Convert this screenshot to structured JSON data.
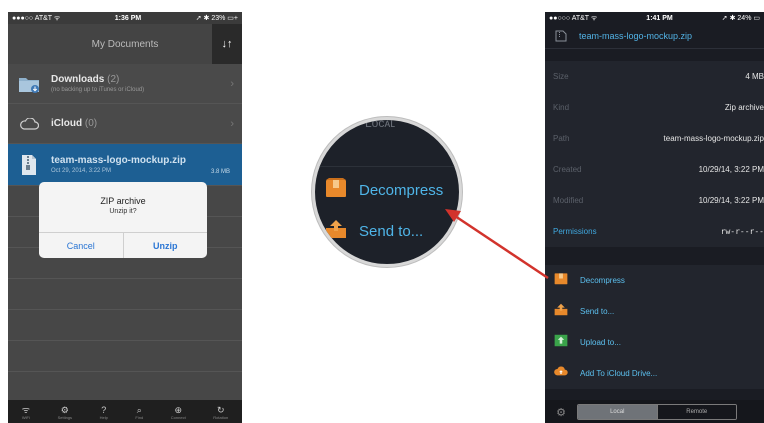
{
  "left_phone": {
    "status": {
      "carrier": "●●●○○ AT&T ᯤ",
      "time": "1:36 PM",
      "battery": "➚ ✱ 23% ▭+"
    },
    "nav": {
      "title": "My Documents",
      "sort_icon": "↓↑"
    },
    "rows": [
      {
        "name": "Downloads",
        "count": "(2)",
        "sub": "(no backing up to iTunes or iCloud)"
      },
      {
        "name": "iCloud",
        "count": "(0)",
        "sub": ""
      },
      {
        "name": "team-mass-logo-mockup.zip",
        "count": "",
        "sub": "Oct 29, 2014, 3:22 PM",
        "size": "3.8 MB"
      }
    ],
    "alert": {
      "title": "ZIP archive",
      "message": "Unzip it?",
      "cancel": "Cancel",
      "confirm": "Unzip"
    },
    "tabbar": [
      {
        "glyph": "ᯤ",
        "label": "WiFi",
        "icon": "wifi-icon"
      },
      {
        "glyph": "⚙",
        "label": "Settings",
        "icon": "gear-icon"
      },
      {
        "glyph": "?",
        "label": "Help",
        "icon": "help-icon"
      },
      {
        "glyph": "⌕",
        "label": "Find",
        "icon": "search-icon"
      },
      {
        "glyph": "⊕",
        "label": "Connect",
        "icon": "globe-icon"
      },
      {
        "glyph": "↻",
        "label": "Rotation",
        "icon": "rotate-icon"
      }
    ]
  },
  "magnifier": {
    "ghost_text": "Lᴏᴄᴀʟ",
    "items": [
      {
        "label": "Decompress",
        "icon": "decompress-icon"
      },
      {
        "label": "Send to...",
        "icon": "send-icon"
      }
    ]
  },
  "right_phone": {
    "status": {
      "carrier": "●●○○○ AT&T ᯤ",
      "time": "1:41 PM",
      "battery": "➚ ✱ 24% ▭"
    },
    "nav": {
      "title": "team-mass-logo-mockup.zip"
    },
    "info": [
      {
        "key": "Size",
        "value": "4 MB"
      },
      {
        "key": "Kind",
        "value": "Zip archive"
      },
      {
        "key": "Path",
        "value": "team-mass-logo-mockup.zip"
      },
      {
        "key": "Created",
        "value": "10/29/14, 3:22 PM"
      },
      {
        "key": "Modified",
        "value": "10/29/14, 3:22 PM"
      },
      {
        "key": "Permissions",
        "value": "rw-r--r--"
      }
    ],
    "actions": [
      {
        "label": "Decompress",
        "icon": "decompress-icon",
        "color": "#e8892b"
      },
      {
        "label": "Send to...",
        "icon": "send-icon",
        "color": "#e8892b"
      },
      {
        "label": "Upload to...",
        "icon": "upload-icon",
        "color": "#3aa34a"
      },
      {
        "label": "Add To iCloud Drive...",
        "icon": "cloud-icon",
        "color": "#e8892b"
      }
    ],
    "tabbar": {
      "local": "Local",
      "remote": "Remote"
    }
  },
  "colors": {
    "accent": "#52b3e6",
    "selection": "#1d5f93",
    "pointer_arrow": "#d2332c"
  }
}
